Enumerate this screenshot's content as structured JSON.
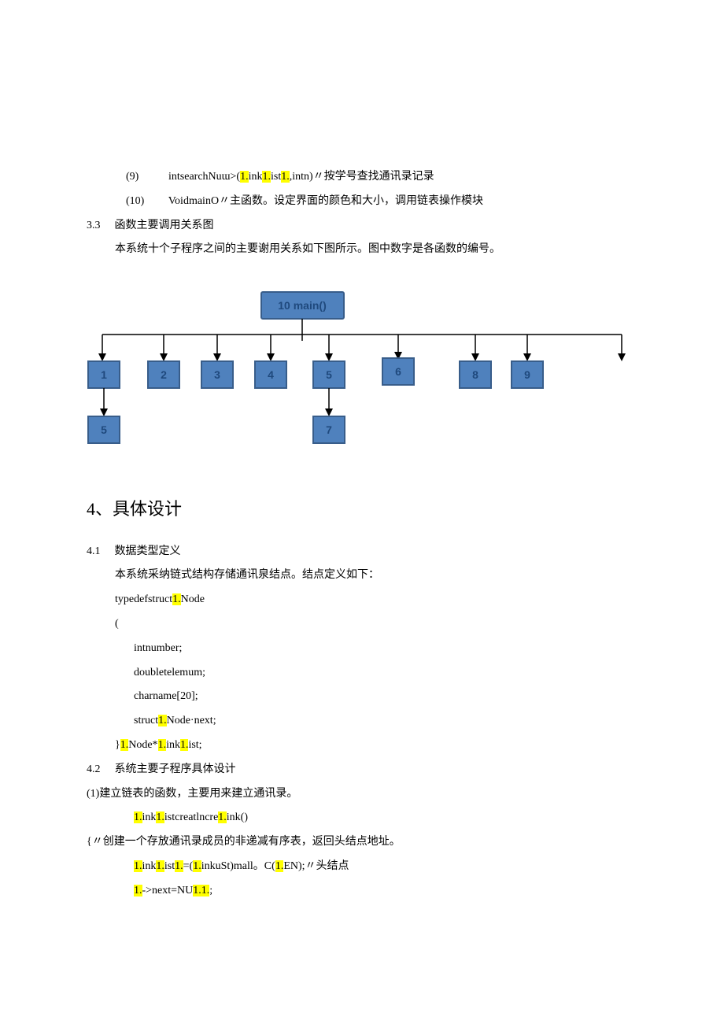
{
  "lines": {
    "l9_num": "(9)",
    "l9_a": "intsearchNuɯ>(",
    "l9_h1": "1.",
    "l9_b": "ink",
    "l9_h2": "1.",
    "l9_c": "ist",
    "l9_h3": "1.",
    "l9_d": ",intn)〃按学号查找通讯录记录",
    "l10_num": "(10)",
    "l10_txt": "VoidmainO〃主函数。设定界面的颜色和大小，调用链表操作模块",
    "s33_num": "3.3",
    "s33_title": "函数主要调用关系图",
    "s33_desc": "本系统十个子程序之间的主要谢用关系如下图所示。图中数字是各函数的编号。",
    "h4": "4、具体设计",
    "s41_num": "4.1",
    "s41_title": "数据类型定义",
    "s41_desc": "本系统采纳链式结构存储通讯泉结点。结点定义如下：",
    "td_a": "typedefstruct",
    "td_h1": "1.",
    "td_b": "Node",
    "brace_open": "(",
    "f1": "intnumber;",
    "f2": "doubletelemum;",
    "f3": "charname[20];",
    "f4_a": "struct",
    "f4_h1": "1.",
    "f4_b": "Node·next;",
    "td_close_a": "}",
    "td_close_h1": "1.",
    "td_close_b": "Node*",
    "td_close_h2": "1.",
    "td_close_c": "ink",
    "td_close_h3": "1.",
    "td_close_d": "ist;",
    "s42_num": "4.2",
    "s42_title": "系统主要子程序具体设计",
    "p1": "(1)建立链表的函数，主要用来建立通讯录。",
    "c1_h1": "1.",
    "c1_a": "ink",
    "c1_h2": "1.",
    "c1_b": "istcreatlncre",
    "c1_h3": "1.",
    "c1_c": "ink()",
    "p2": "{〃创建一个存放通讯录成员的非递减有序表，返回头结点地址。",
    "c2_h1": "1.",
    "c2_a": "ink",
    "c2_h2": "1.",
    "c2_b": "ist",
    "c2_h3": "1.",
    "c2_c": "=(",
    "c2_h4": "1.",
    "c2_d": "inkuSt)mall。C(",
    "c2_h5": "1.",
    "c2_e": "EN);〃头结点",
    "c3_h1": "1.",
    "c3_a": "->next=NU",
    "c3_h2": "1.1.",
    "c3_b": ";"
  },
  "diagram": {
    "top": "10 main()",
    "row1": [
      "1",
      "2",
      "3",
      "4",
      "5",
      "6",
      "8",
      "9"
    ],
    "below": {
      "under1": "5",
      "under5": "7"
    }
  }
}
